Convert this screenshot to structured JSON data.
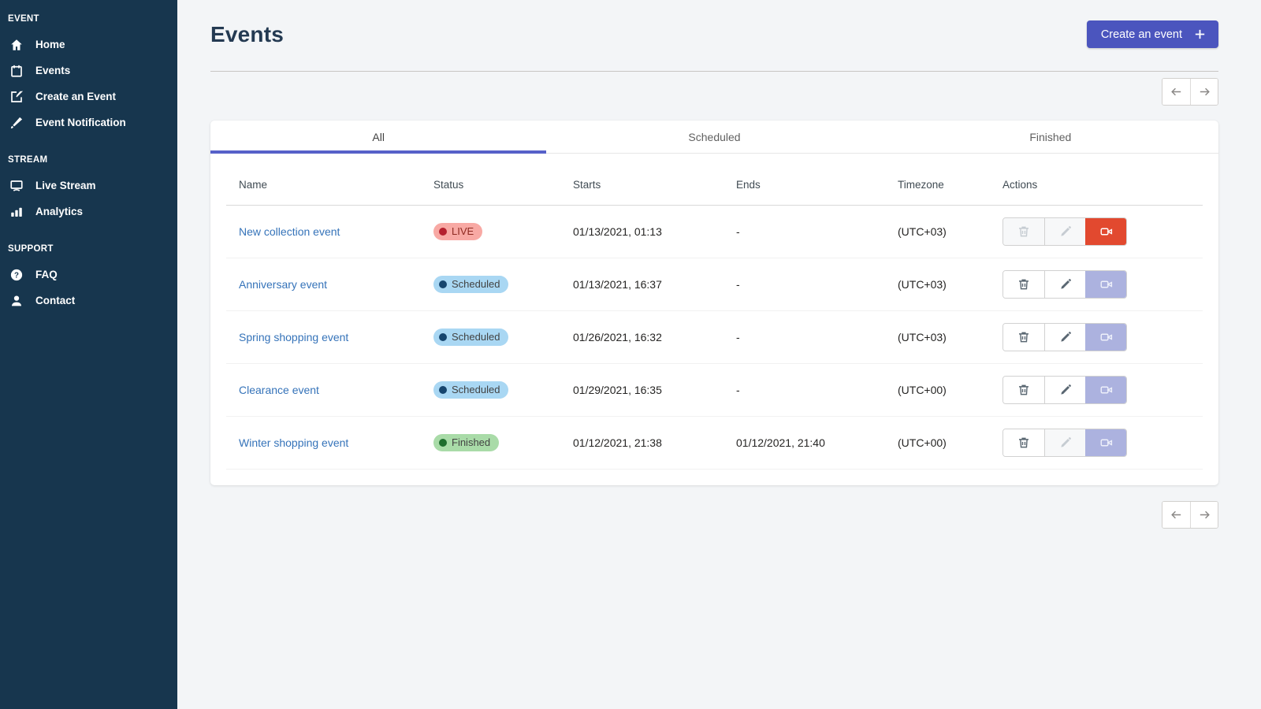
{
  "sidebar": {
    "sections": [
      {
        "label": "EVENT",
        "items": [
          {
            "label": "Home",
            "icon": "home-icon"
          },
          {
            "label": "Events",
            "icon": "calendar-icon"
          },
          {
            "label": "Create an Event",
            "icon": "compose-icon"
          },
          {
            "label": "Event Notification",
            "icon": "brush-icon"
          }
        ]
      },
      {
        "label": "STREAM",
        "items": [
          {
            "label": "Live Stream",
            "icon": "monitor-icon"
          },
          {
            "label": "Analytics",
            "icon": "bar-chart-icon"
          }
        ]
      },
      {
        "label": "SUPPORT",
        "items": [
          {
            "label": "FAQ",
            "icon": "question-circle-icon"
          },
          {
            "label": "Contact",
            "icon": "person-icon"
          }
        ]
      }
    ]
  },
  "header": {
    "title": "Events",
    "create_button_label": "Create an event"
  },
  "tabs": [
    {
      "label": "All",
      "active": true
    },
    {
      "label": "Scheduled",
      "active": false
    },
    {
      "label": "Finished",
      "active": false
    }
  ],
  "table": {
    "columns": {
      "name": "Name",
      "status": "Status",
      "starts": "Starts",
      "ends": "Ends",
      "timezone": "Timezone",
      "actions": "Actions"
    },
    "rows": [
      {
        "name": "New collection event",
        "status": "LIVE",
        "status_type": "live",
        "starts": "01/13/2021, 01:13",
        "ends": "-",
        "timezone": "(UTC+03)",
        "actions": {
          "delete_enabled": false,
          "edit_enabled": false,
          "video_state": "live"
        }
      },
      {
        "name": "Anniversary event",
        "status": "Scheduled",
        "status_type": "scheduled",
        "starts": "01/13/2021, 16:37",
        "ends": "-",
        "timezone": "(UTC+03)",
        "actions": {
          "delete_enabled": true,
          "edit_enabled": true,
          "video_state": "disabled"
        }
      },
      {
        "name": "Spring shopping event",
        "status": "Scheduled",
        "status_type": "scheduled",
        "starts": "01/26/2021, 16:32",
        "ends": "-",
        "timezone": "(UTC+03)",
        "actions": {
          "delete_enabled": true,
          "edit_enabled": true,
          "video_state": "disabled"
        }
      },
      {
        "name": "Clearance event",
        "status": "Scheduled",
        "status_type": "scheduled",
        "starts": "01/29/2021, 16:35",
        "ends": "-",
        "timezone": "(UTC+00)",
        "actions": {
          "delete_enabled": true,
          "edit_enabled": true,
          "video_state": "disabled"
        }
      },
      {
        "name": "Winter shopping event",
        "status": "Finished",
        "status_type": "finished",
        "starts": "01/12/2021, 21:38",
        "ends": "01/12/2021, 21:40",
        "timezone": "(UTC+00)",
        "actions": {
          "delete_enabled": true,
          "edit_enabled": false,
          "video_state": "disabled"
        }
      }
    ]
  },
  "colors": {
    "sidebar_bg": "#17364E",
    "accent_button": "#4B55BE",
    "tab_underline": "#5661C9",
    "link_blue": "#3573B9",
    "live_red": "#E2492F",
    "badge_live_bg": "#F8A9A4",
    "badge_scheduled_bg": "#A9D7F3",
    "badge_finished_bg": "#A9DBA8",
    "video_disabled_bg": "#ACB2DF"
  }
}
